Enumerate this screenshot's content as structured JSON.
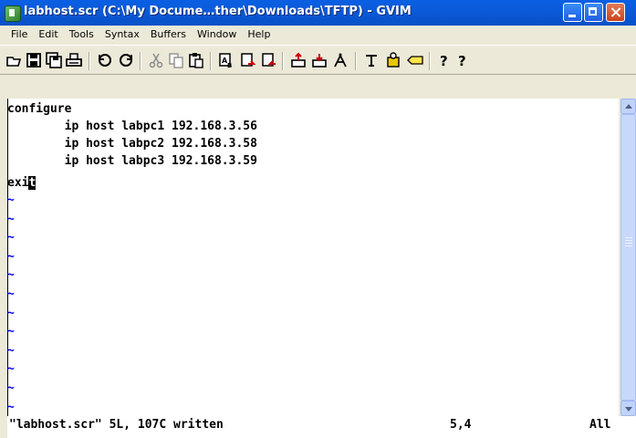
{
  "window": {
    "title": "labhost.scr (C:\\My Docume…ther\\Downloads\\TFTP) - GVIM",
    "app_icon": "gvim-icon"
  },
  "menu": [
    "File",
    "Edit",
    "Tools",
    "Syntax",
    "Buffers",
    "Window",
    "Help"
  ],
  "toolbar": {
    "groups": [
      [
        "open-icon",
        "save-icon",
        "save-all-icon",
        "print-icon"
      ],
      [
        "undo-icon",
        "redo-icon"
      ],
      [
        "cut-icon",
        "copy-icon",
        "paste-icon"
      ],
      [
        "replace-icon",
        "find-next-icon",
        "find-prev-icon"
      ],
      [
        "load-session-icon",
        "save-session-icon",
        "run-script-icon"
      ],
      [
        "make-icon",
        "shell-icon",
        "tag-icon"
      ],
      [
        "help-icon",
        "find-help-icon"
      ]
    ]
  },
  "buffer": {
    "lines": [
      "configure",
      "        ip host labpc1 192.168.3.56",
      "        ip host labpc2 192.168.3.58",
      "        ip host labpc3 192.168.3.59"
    ],
    "cursor_line_before": "exi",
    "cursor_char": "t",
    "cursor_line_after": "",
    "empty_marker": "~",
    "empty_line_count": 12
  },
  "status": {
    "message": "\"labhost.scr\" 5L, 107C written",
    "position": "5,4",
    "scroll": "All"
  },
  "colors": {
    "titlebar": "#0a5fe3",
    "tilde": "#0000ff",
    "chrome": "#ece9d8"
  }
}
